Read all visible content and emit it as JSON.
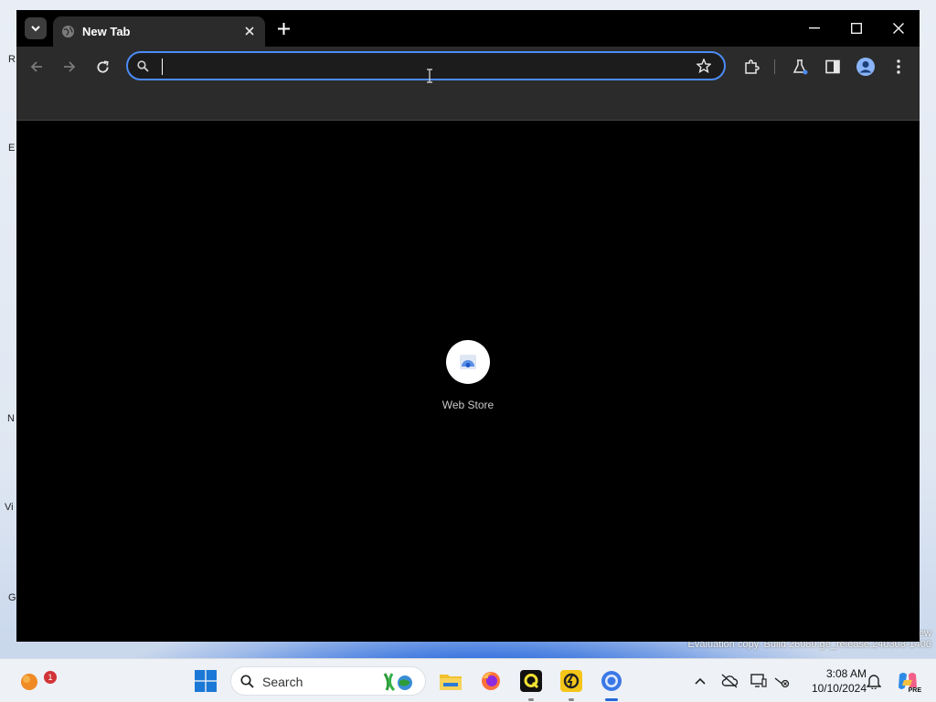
{
  "desktop": {
    "icon_fragments": [
      "R",
      "E",
      "N",
      "Vi",
      "G"
    ],
    "watermark_line1": "ew",
    "watermark_line2": "Evaluation copy. Build 26080.ge_release.240308-1400"
  },
  "browser": {
    "tab": {
      "title": "New Tab",
      "favicon": "globe-icon"
    },
    "toolbar": {
      "back_icon": "arrow-left-icon",
      "forward_icon": "arrow-right-icon",
      "reload_icon": "reload-icon",
      "omnibox": {
        "value": "",
        "placeholder": ""
      },
      "bookmark_icon": "star-icon",
      "extensions_icon": "puzzle-icon",
      "labs_icon": "flask-icon",
      "side_panel_icon": "side-panel-icon",
      "profile_icon": "profile-icon",
      "menu_icon": "kebab-menu-icon"
    },
    "shortcuts": [
      {
        "label": "Web Store"
      }
    ],
    "colors": {
      "accent": "#4c8bf5",
      "frame": "#000000",
      "toolbar": "#2b2b2b"
    }
  },
  "taskbar": {
    "search_label": "Search",
    "notification_count": "1",
    "clock": {
      "time": "3:08 AM",
      "date": "10/10/2024"
    },
    "apps": [
      "start",
      "search",
      "widget",
      "file-explorer",
      "firefox",
      "qq-app",
      "lightning-app",
      "chrome"
    ],
    "copilot_badge": "PRE"
  }
}
